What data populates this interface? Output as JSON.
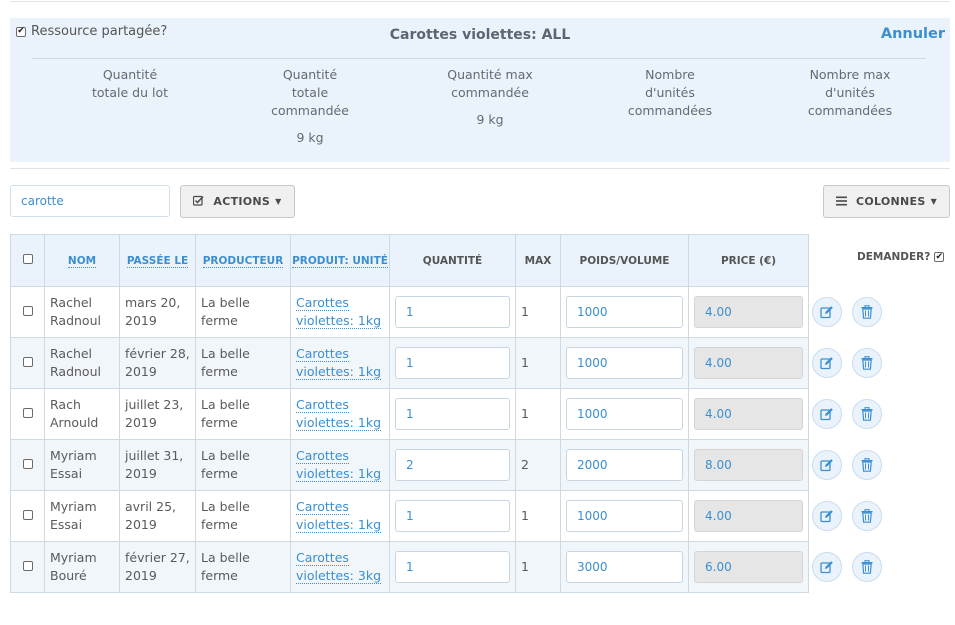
{
  "panel": {
    "shared_label": "Ressource partagée?",
    "shared_checked": "✔",
    "title": "Carottes violettes: ALL",
    "cancel_label": "Annuler",
    "stats": [
      {
        "label": "Quantité\ntotale du lot",
        "value": ""
      },
      {
        "label": "Quantité\ntotale\ncommandée",
        "value": "9 kg"
      },
      {
        "label": "Quantité max\ncommandée",
        "value": "9 kg"
      },
      {
        "label": "Nombre\nd'unités\ncommandées",
        "value": ""
      },
      {
        "label": "Nombre max\nd'unités\ncommandées",
        "value": ""
      }
    ]
  },
  "toolbar": {
    "search_value": "carotte",
    "actions_label": "ACTIONS",
    "columns_label": "COLONNES"
  },
  "table": {
    "headers": {
      "name": "NOM",
      "date": "PASSÉE LE",
      "producer": "PRODUCTEUR",
      "product": "PRODUIT: UNITÉ",
      "quantity": "QUANTITÉ",
      "max": "MAX",
      "weight": "POIDS/VOLUME",
      "price": "PRICE (€)",
      "ask": "DEMANDER?"
    },
    "ask_checked": "✔",
    "rows": [
      {
        "name": "Rachel Radnoul",
        "date": "mars 20, 2019",
        "producer": "La belle ferme",
        "product": "Carottes violettes: 1kg",
        "quantity": "1",
        "max": "1",
        "weight": "1000",
        "price": "4.00"
      },
      {
        "name": "Rachel Radnoul",
        "date": "février 28, 2019",
        "producer": "La belle ferme",
        "product": "Carottes violettes: 1kg",
        "quantity": "1",
        "max": "1",
        "weight": "1000",
        "price": "4.00"
      },
      {
        "name": "Rach Arnould",
        "date": "juillet 23, 2019",
        "producer": "La belle ferme",
        "product": "Carottes violettes: 1kg",
        "quantity": "1",
        "max": "1",
        "weight": "1000",
        "price": "4.00"
      },
      {
        "name": "Myriam Essai",
        "date": "juillet 31, 2019",
        "producer": "La belle ferme",
        "product": "Carottes violettes: 1kg",
        "quantity": "2",
        "max": "2",
        "weight": "2000",
        "price": "8.00"
      },
      {
        "name": "Myriam Essai",
        "date": "avril 25, 2019",
        "producer": "La belle ferme",
        "product": "Carottes violettes: 1kg",
        "quantity": "1",
        "max": "1",
        "weight": "1000",
        "price": "4.00"
      },
      {
        "name": "Myriam Bouré",
        "date": "février 27, 2019",
        "producer": "La belle ferme",
        "product": "Carottes violettes: 3kg",
        "quantity": "1",
        "max": "1",
        "weight": "3000",
        "price": "6.00"
      }
    ]
  },
  "icons": {
    "edit": "edit-icon",
    "delete": "trash-icon",
    "actions": "checkbox-icon",
    "columns": "menu-icon",
    "caret": "caret-down-icon"
  },
  "colors": {
    "accent": "#3b8fd1",
    "panel_bg": "#eaf3fb",
    "row_alt_bg": "#f1f6fb",
    "readonly_bg": "#e6e6e6"
  }
}
